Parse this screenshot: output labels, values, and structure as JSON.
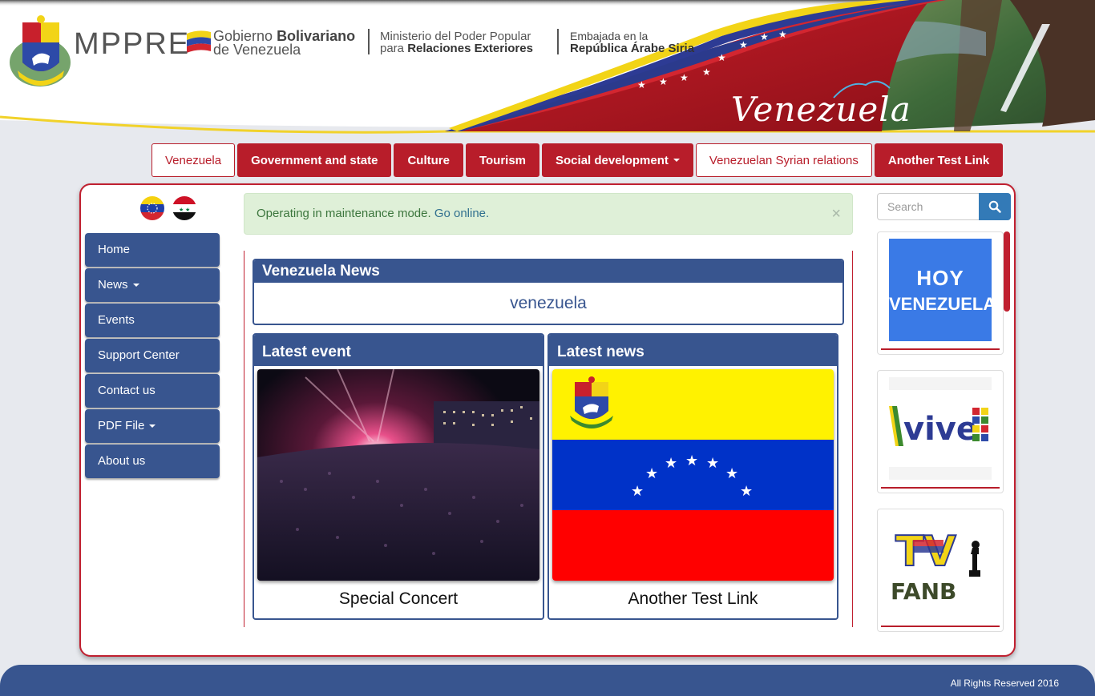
{
  "header": {
    "mppre": "MPPRE",
    "gobierno_line1_a": "Gobierno ",
    "gobierno_line1_b": "Bolivariano",
    "gobierno_line2": "de Venezuela",
    "ministerio_line1": "Ministerio del Poder Popular",
    "ministerio_line2_a": "para ",
    "ministerio_line2_b": "Relaciones Exteriores",
    "embajada_line1": "Embajada en la",
    "embajada_line2": "República Árabe Siria",
    "venezuela_word": "Venezuela"
  },
  "topnav": {
    "items": [
      {
        "label": "Venezuela",
        "style": "white"
      },
      {
        "label": "Government and state",
        "style": "red"
      },
      {
        "label": "Culture",
        "style": "red"
      },
      {
        "label": "Tourism",
        "style": "red"
      },
      {
        "label": "Social development",
        "style": "red",
        "dropdown": true
      },
      {
        "label": "Venezuelan Syrian relations",
        "style": "white"
      },
      {
        "label": "Another Test Link",
        "style": "red"
      }
    ]
  },
  "sidebar": {
    "items": [
      {
        "label": "Home"
      },
      {
        "label": "News",
        "dropdown": true
      },
      {
        "label": "Events"
      },
      {
        "label": "Support Center"
      },
      {
        "label": "Contact us"
      },
      {
        "label": "PDF File",
        "dropdown": true
      },
      {
        "label": "About us"
      }
    ]
  },
  "alert": {
    "text": "Operating in maintenance mode. ",
    "link": "Go online.",
    "close": "×"
  },
  "news_panel": {
    "title": "Venezuela News",
    "body": "venezuela"
  },
  "event_panel": {
    "title": "Latest event",
    "card_title": "Special Concert"
  },
  "latest_news_panel": {
    "title": "Latest news",
    "card_title": "Another Test Link"
  },
  "search": {
    "placeholder": "Search"
  },
  "ads": {
    "hoy_line1": "HOY",
    "hoy_line2": "VENEZUELA",
    "vive": "vive",
    "tv": "TV",
    "fanb": "FANB"
  },
  "footer": {
    "text": "All Rights Reserved 2016"
  },
  "colors": {
    "brand_blue": "#38558f",
    "brand_red": "#b81d2a",
    "alert_bg": "#dff0d8",
    "search_btn": "#337ab7"
  }
}
